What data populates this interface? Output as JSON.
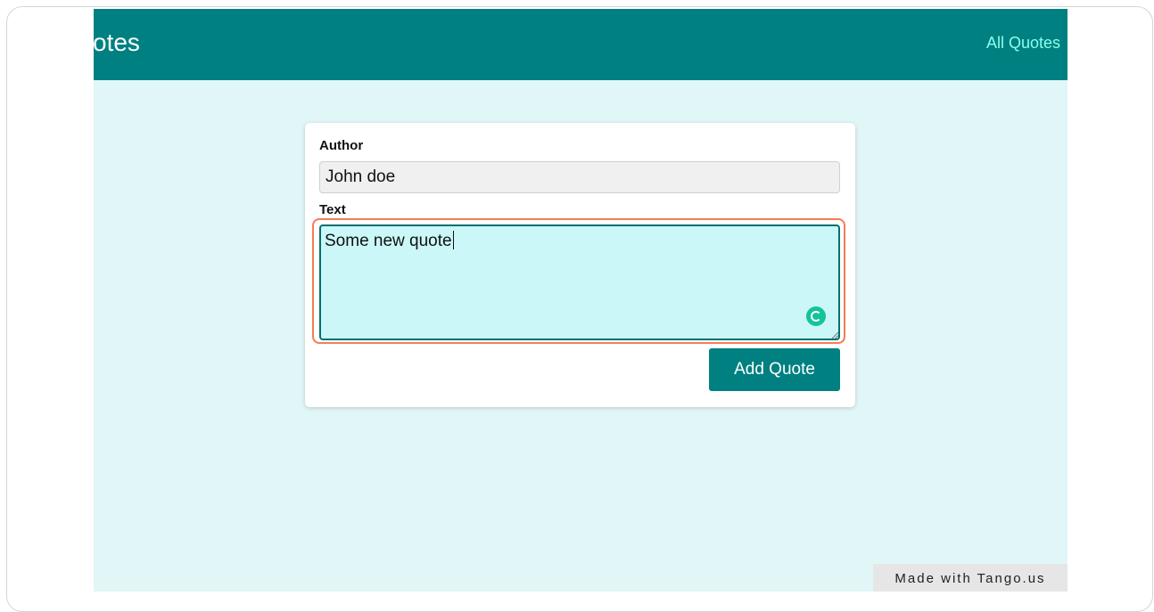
{
  "header": {
    "brand_text": "otes",
    "nav_link": "All Quotes"
  },
  "form": {
    "author_label": "Author",
    "author_value": "John doe",
    "text_label": "Text",
    "text_value": "Some new quote",
    "submit_label": "Add Quote"
  },
  "badge": {
    "text": "Made with Tango.us"
  },
  "icons": {
    "grammarly": "grammarly-icon",
    "resize": "resize-grip-icon"
  },
  "colors": {
    "header_bg": "#008080",
    "page_bg": "#e1f6f6",
    "link": "#88ffef",
    "textarea_bg": "#cbf7f8",
    "highlight": "#f47d57",
    "button_bg": "#008080"
  }
}
